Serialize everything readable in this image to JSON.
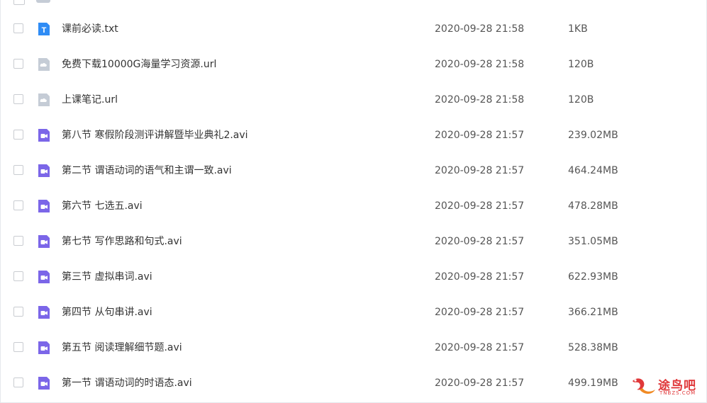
{
  "files": [
    {
      "name": "课前必读.txt",
      "date": "2020-09-28 21:58",
      "size": "1KB",
      "type": "txt"
    },
    {
      "name": "免费下载10000G海量学习资源.url",
      "date": "2020-09-28 21:58",
      "size": "120B",
      "type": "url"
    },
    {
      "name": "上课笔记.url",
      "date": "2020-09-28 21:58",
      "size": "120B",
      "type": "url"
    },
    {
      "name": "第八节 寒假阶段测评讲解暨毕业典礼2.avi",
      "date": "2020-09-28 21:57",
      "size": "239.02MB",
      "type": "video"
    },
    {
      "name": "第二节 谓语动词的语气和主谓一致.avi",
      "date": "2020-09-28 21:57",
      "size": "464.24MB",
      "type": "video"
    },
    {
      "name": "第六节 七选五.avi",
      "date": "2020-09-28 21:57",
      "size": "478.28MB",
      "type": "video"
    },
    {
      "name": "第七节 写作思路和句式.avi",
      "date": "2020-09-28 21:57",
      "size": "351.05MB",
      "type": "video"
    },
    {
      "name": "第三节 虚拟串词.avi",
      "date": "2020-09-28 21:57",
      "size": "622.93MB",
      "type": "video"
    },
    {
      "name": "第四节 从句串讲.avi",
      "date": "2020-09-28 21:57",
      "size": "366.21MB",
      "type": "video"
    },
    {
      "name": "第五节 阅读理解细节题.avi",
      "date": "2020-09-28 21:57",
      "size": "528.38MB",
      "type": "video"
    },
    {
      "name": "第一节 谓语动词的时语态.avi",
      "date": "2020-09-28 21:57",
      "size": "499.19MB",
      "type": "video"
    }
  ],
  "icons": {
    "txt": {
      "name": "text-file-icon",
      "color": "#2f8cf5",
      "glyph": "T"
    },
    "url": {
      "name": "cloud-link-icon",
      "color": "#c5ccd6"
    },
    "video": {
      "name": "video-file-icon",
      "color": "#7b66e8"
    }
  },
  "watermark": {
    "text": "途鸟吧",
    "sub": "TNBZS.COM",
    "color": "#e0383a"
  }
}
